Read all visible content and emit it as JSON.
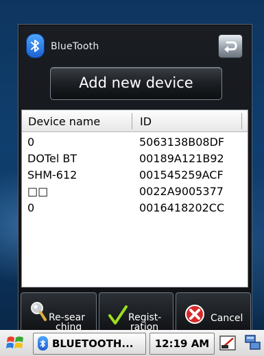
{
  "header": {
    "app_title": "BlueTooth",
    "add_button_label": "Add new device"
  },
  "device_list": {
    "columns": [
      "Device name",
      "ID"
    ],
    "rows": [
      {
        "name": "0",
        "id": "5063138B08DF"
      },
      {
        "name": "DOTel BT",
        "id": "00189A121B92"
      },
      {
        "name": "SHM-612",
        "id": "001545259ACF"
      },
      {
        "name": "□□",
        "id": "0022A9005377"
      },
      {
        "name": "0",
        "id": "0016418202CC"
      }
    ]
  },
  "actions": {
    "research": {
      "line1": "Re-sear",
      "line2": "ching",
      "icon": "magnifier-icon"
    },
    "registration": {
      "line1": "Regist-",
      "line2": "ration",
      "icon": "checkmark-icon"
    },
    "cancel": {
      "label": "Cancel",
      "icon": "cancel-x-icon"
    }
  },
  "taskbar": {
    "task_label": "BLUETOOTH...",
    "clock": "12:19 AM"
  },
  "colors": {
    "bluetooth_blue": "#1b5fd0",
    "frame_dark": "#0e1013",
    "background_blue": "#0f3f6e",
    "cancel_red": "#d42a2a",
    "check_green": "#9be01f"
  }
}
